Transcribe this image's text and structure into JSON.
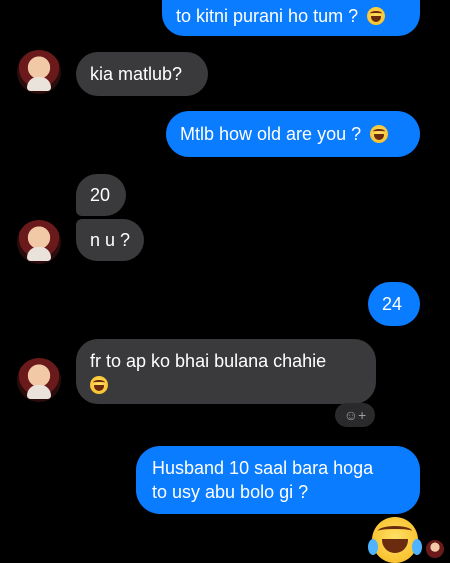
{
  "messages": [
    {
      "text": "to kitni purani ho tum ?"
    },
    {
      "text": "kia matlub?"
    },
    {
      "text": "Mtlb how old are you ?"
    },
    {
      "text": "20"
    },
    {
      "text": "n u ?"
    },
    {
      "text": "24"
    },
    {
      "text": "fr to ap ko bhai bulana chahie"
    },
    {
      "text": "Husband 10 saal bara hoga"
    },
    {
      "text": "to usy abu bolo gi ?"
    }
  ],
  "reaction_button": {
    "label": "☺+"
  },
  "icons": [
    "grinning-sweat-emoji-icon",
    "avatar",
    "add-reaction-icon",
    "tears-of-joy-emoji-icon"
  ],
  "colors": {
    "outgoing": "#0a7cff",
    "incoming": "#3a3a3c",
    "background": "#000000"
  }
}
